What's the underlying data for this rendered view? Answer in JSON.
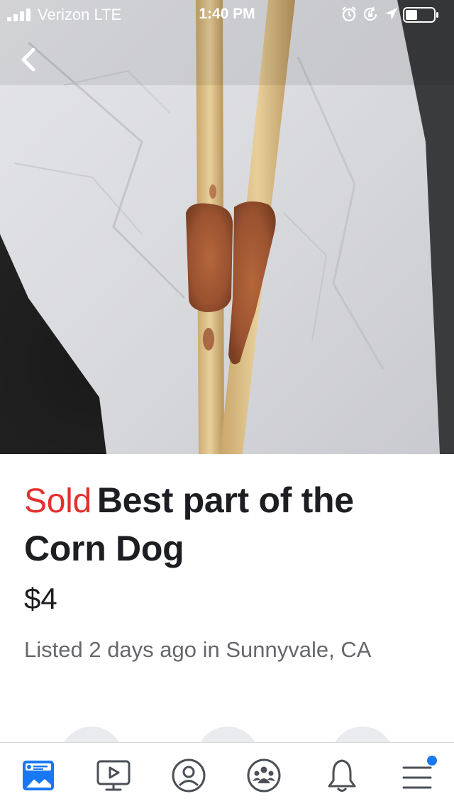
{
  "status_bar": {
    "carrier": "Verizon LTE",
    "time": "1:40 PM",
    "icons": [
      "signal-icon",
      "alarm-icon",
      "lock-rotation-icon",
      "location-icon",
      "battery-icon"
    ]
  },
  "photo": {
    "description_icon": "product-photo"
  },
  "listing": {
    "status": "Sold",
    "title": "Best part of the Corn Dog",
    "price": "$4",
    "listed_info": "Listed 2 days ago in Sunnyvale, CA"
  },
  "colors": {
    "sold": "#e4302f",
    "accent": "#1877f2",
    "tab_icon": "#4b4f56",
    "secondary_text": "#65676b"
  },
  "tabs": [
    {
      "name": "news-feed",
      "icon": "news-feed-icon",
      "active": true
    },
    {
      "name": "watch",
      "icon": "watch-icon",
      "active": false
    },
    {
      "name": "profile",
      "icon": "profile-icon",
      "active": false
    },
    {
      "name": "groups",
      "icon": "groups-icon",
      "active": false
    },
    {
      "name": "notifications",
      "icon": "bell-icon",
      "active": false
    },
    {
      "name": "menu",
      "icon": "menu-icon",
      "active": false,
      "badge": true
    }
  ]
}
